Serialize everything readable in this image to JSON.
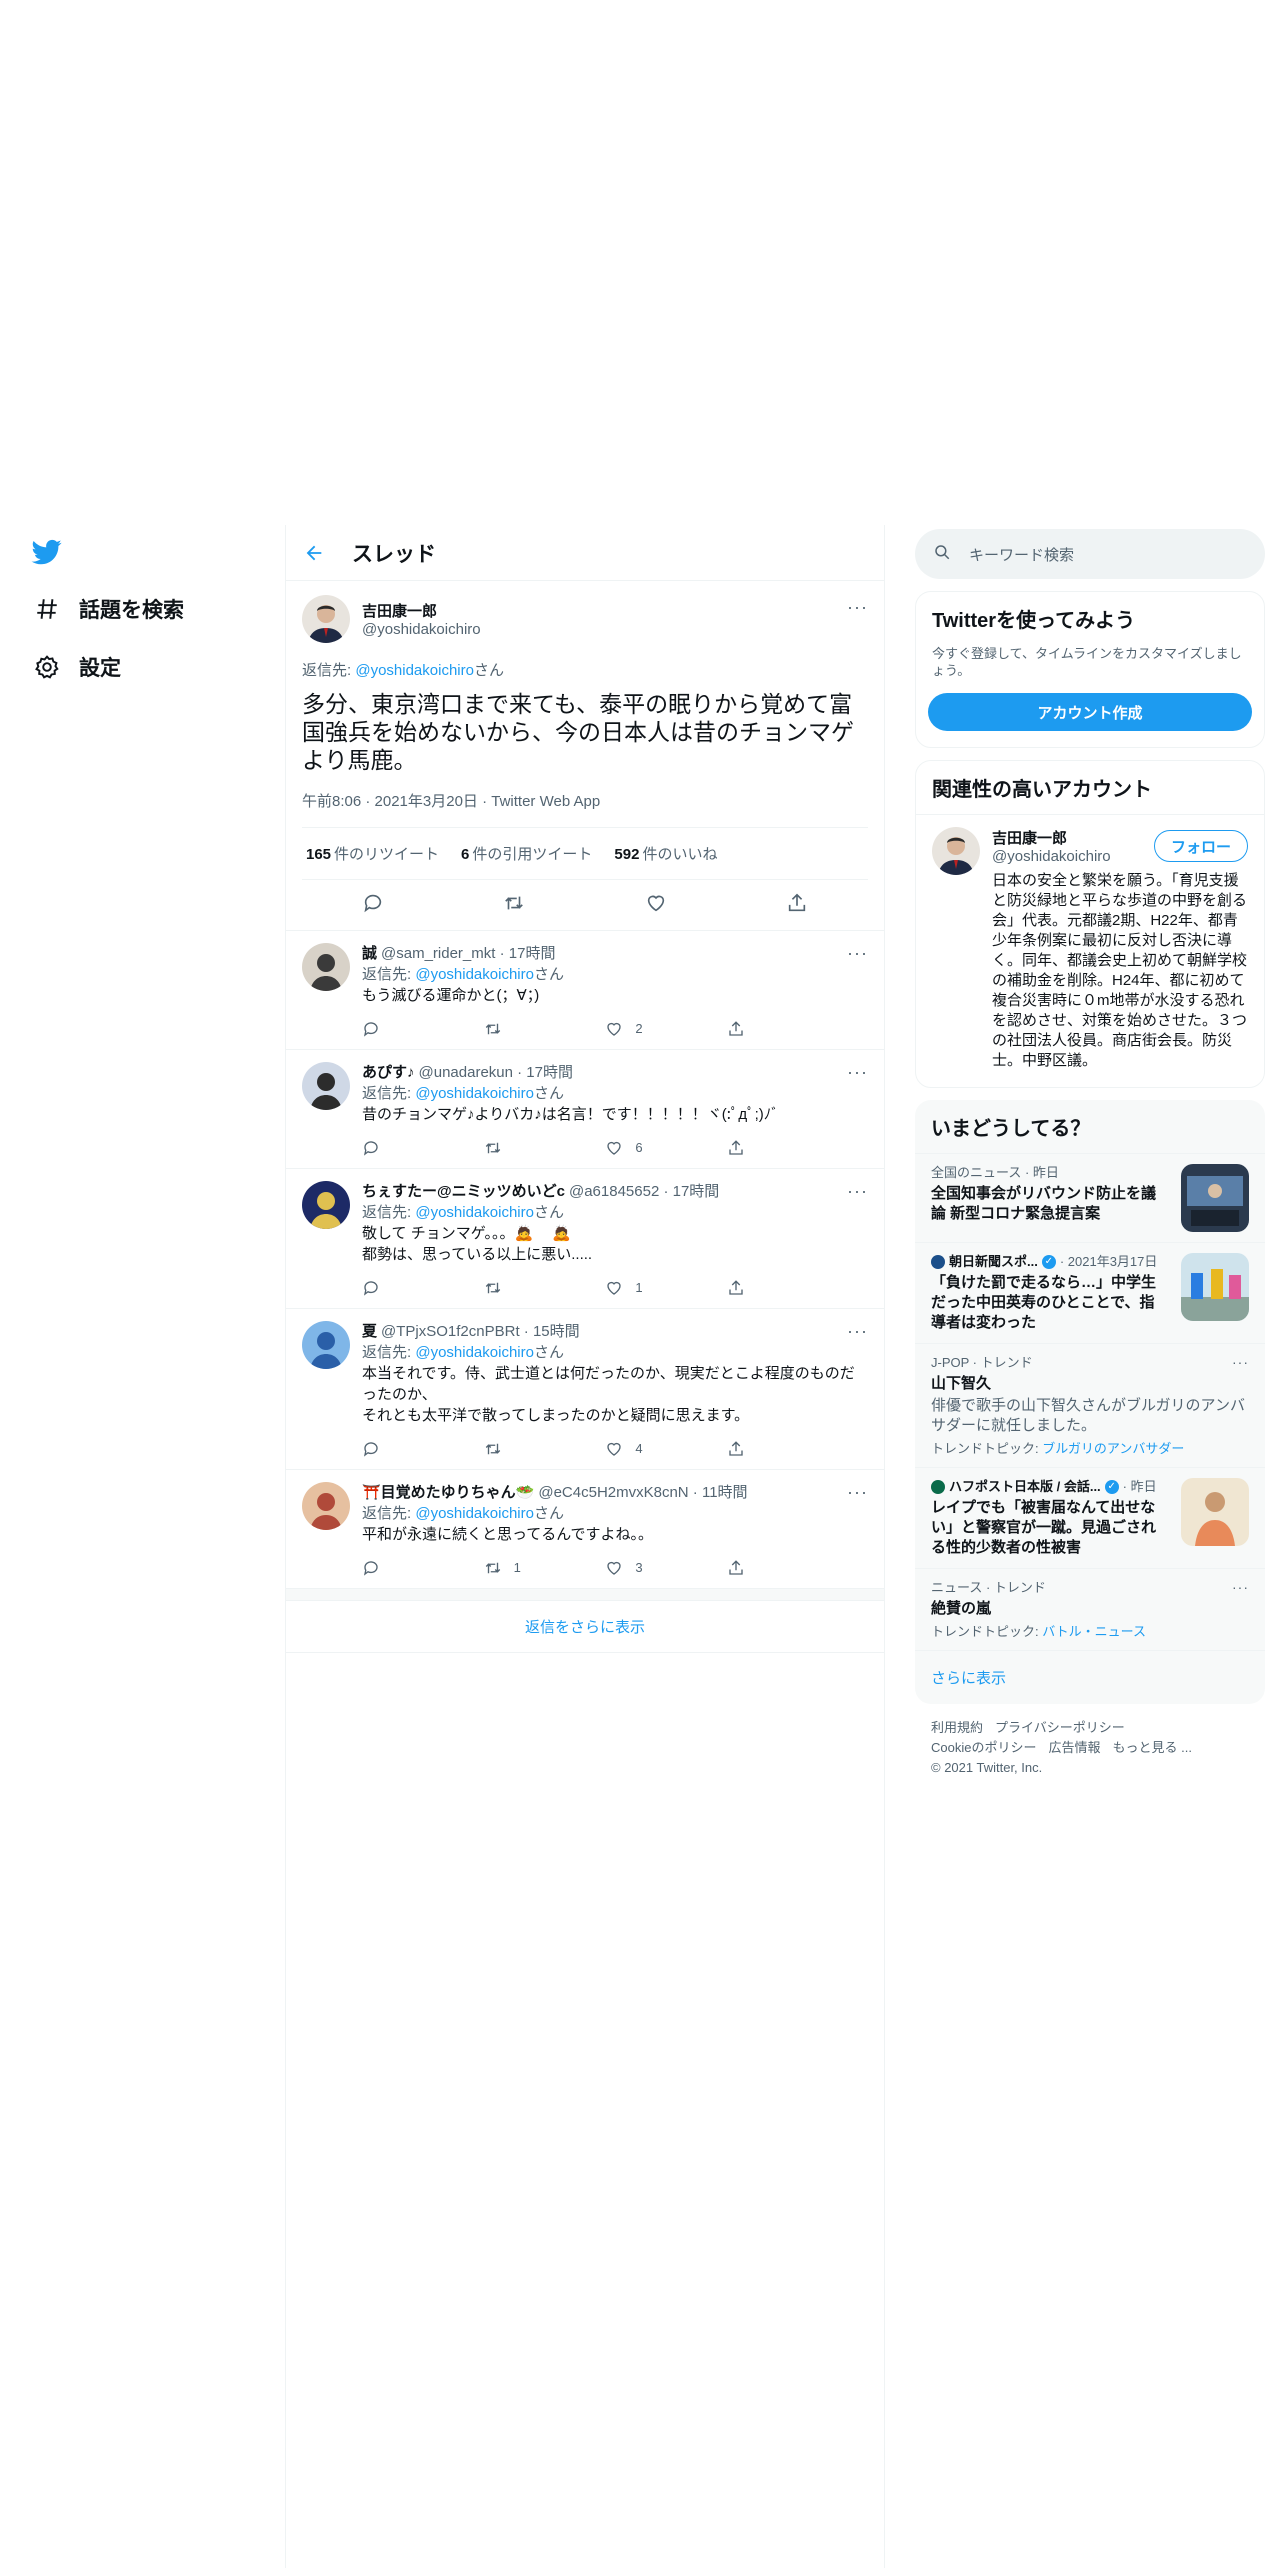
{
  "nav": {
    "explore_label": "話題を検索",
    "settings_label": "設定"
  },
  "header": {
    "title": "スレッド"
  },
  "focal": {
    "name": "吉田康一郎",
    "handle": "@yoshidakoichiro",
    "reply_prefix": "返信先: ",
    "reply_to": "@yoshidakoichiro",
    "reply_suffix": "さん",
    "text": "多分、東京湾口まで来ても、泰平の眠りから覚めて富国強兵を始めないから、今の日本人は昔のチョンマゲより馬鹿。",
    "meta": "午前8:06 · 2021年3月20日 · Twitter Web App",
    "retweets_count": "165",
    "retweets_label": "件のリツイート",
    "quotes_count": "6",
    "quotes_label": "件の引用ツイート",
    "likes_count": "592",
    "likes_label": "件のいいね"
  },
  "replies": [
    {
      "name": "誠",
      "handle": "@sam_rider_mkt · 17時間",
      "reply_to": "@yoshidakoichiro",
      "text": "もう滅びる運命かと(；∀；)",
      "retweets": "",
      "likes": "2"
    },
    {
      "name": "あぴす♪",
      "handle": "@unadarekun · 17時間",
      "reply_to": "@yoshidakoichiro",
      "text": "昔のチョンマゲ♪よりバカ♪は名言！です！！！！！ヾ(:ﾟдﾟ;)ﾉﾞ",
      "retweets": "",
      "likes": "6"
    },
    {
      "name": "ちぇすたー@ニミッツめいどc",
      "handle": "@a61845652 · 17時間",
      "reply_to": "@yoshidakoichiro",
      "text": "敬して チョンマゲ。。。🙇 　🙇\n都勢は、思っている以上に悪い.....",
      "retweets": "",
      "likes": "1"
    },
    {
      "name": "夏",
      "handle": "@TPjxSO1f2cnPBRt · 15時間",
      "reply_to": "@yoshidakoichiro",
      "text": "本当それです。侍、武士道とは何だったのか、現実だとこよ程度のものだったのか、\nそれとも太平洋で散ってしまったのかと疑問に思えます。",
      "retweets": "",
      "likes": "4"
    },
    {
      "name": "⛩️目覚めたゆりちゃん🥗",
      "handle": "@eC4c5H2mvxK8cnN · 11時間",
      "reply_to": "@yoshidakoichiro",
      "text": "平和が永遠に続くと思ってるんですよね。。",
      "retweets": "1",
      "likes": "3"
    }
  ],
  "reply_common": {
    "prefix": "返信先: ",
    "suffix": "さん"
  },
  "show_more": "返信をさらに表示",
  "search": {
    "placeholder": "キーワード検索"
  },
  "signup": {
    "title": "Twitterを使ってみよう",
    "subtitle": "今すぐ登録して、タイムラインをカスタマイズしましょう。",
    "button": "アカウント作成"
  },
  "related": {
    "title": "関連性の高いアカウント",
    "name": "吉田康一郎",
    "handle": "@yoshidakoichiro",
    "follow": "フォロー",
    "bio": "日本の安全と繁栄を願う。「育児支援と防災緑地と平らな歩道の中野を創る会」代表。元都議2期、H22年、都青少年条例案に最初に反対し否決に導く。同年、都議会史上初めて朝鮮学校の補助金を削除。H24年、都に初めて複合災害時に０m地帯が水没する恐れを認めさせ、対策を始めさせた。３つの社団法人役員。商店街会長。防災士。中野区議。"
  },
  "trends": {
    "title": "いまどうしてる？",
    "items": [
      {
        "meta": "全国のニュース · 昨日",
        "title": "全国知事会がリバウンド防止を議論 新型コロナ緊急提言案"
      },
      {
        "meta_source": "朝日新聞スポ...",
        "meta_date": "· 2021年3月17日",
        "title": "「負けた罰で走るなら…」中学生だった中田英寿のひとことで、指導者は変わった"
      },
      {
        "meta": "J-POP · トレンド",
        "title": "山下智久",
        "desc": "俳優で歌手の山下智久さんがブルガリのアンバサダーに就任しました。",
        "sub_label": "トレンドトピック: ",
        "sub_link": "ブルガリのアンバサダー"
      },
      {
        "meta_source": "ハフポスト日本版 / 会話...",
        "meta_date": "· 昨日",
        "title": "レイプでも「被害届なんて出せない」と警察官が一蹴。見過ごされる性的少数者の性被害"
      },
      {
        "meta": "ニュース · トレンド",
        "title": "絶賛の嵐",
        "sub_label": "トレンドトピック: ",
        "sub_link": "バトル・ニュース"
      }
    ],
    "show_more": "さらに表示"
  },
  "footer": {
    "terms": "利用規約",
    "privacy": "プライバシーポリシー",
    "cookie": "Cookieのポリシー",
    "ads": "広告情報",
    "more": "もっと見る ...",
    "copyright": "© 2021 Twitter, Inc."
  },
  "colors": {
    "accent": "#1d9bf0",
    "text": "#0f1419",
    "muted": "#536471",
    "panel": "#f7f9f9"
  }
}
